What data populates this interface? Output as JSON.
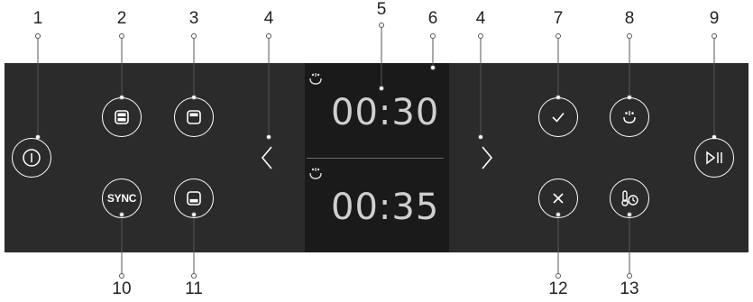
{
  "callouts": {
    "c1": "1",
    "c2": "2",
    "c3": "3",
    "c4a": "4",
    "c5": "5",
    "c6": "6",
    "c4b": "4",
    "c7": "7",
    "c8": "8",
    "c9": "9",
    "c10": "10",
    "c11": "11",
    "c12": "12",
    "c13": "13"
  },
  "display": {
    "timer_top": "00:30",
    "timer_bottom": "00:35"
  },
  "buttons": {
    "sync_label": "SYNC"
  },
  "icons": {
    "power": "power-icon",
    "full_cavity": "full-cavity-icon",
    "top_cavity": "top-cavity-icon",
    "sync": "sync-icon",
    "bottom_cavity": "bottom-cavity-icon",
    "left_arrow": "chevron-left-icon",
    "right_arrow": "chevron-right-icon",
    "steam_clean": "steam-clean-icon",
    "confirm": "checkmark-icon",
    "steam_function": "steam-icon",
    "start_pause": "start-pause-icon",
    "cancel": "close-icon",
    "temperature_timer": "temperature-timer-icon"
  },
  "colors": {
    "panel": "#2b2b2b",
    "display": "#1a1a1a",
    "button_outline": "#ffffff",
    "timer_text": "#cfcfcf"
  }
}
